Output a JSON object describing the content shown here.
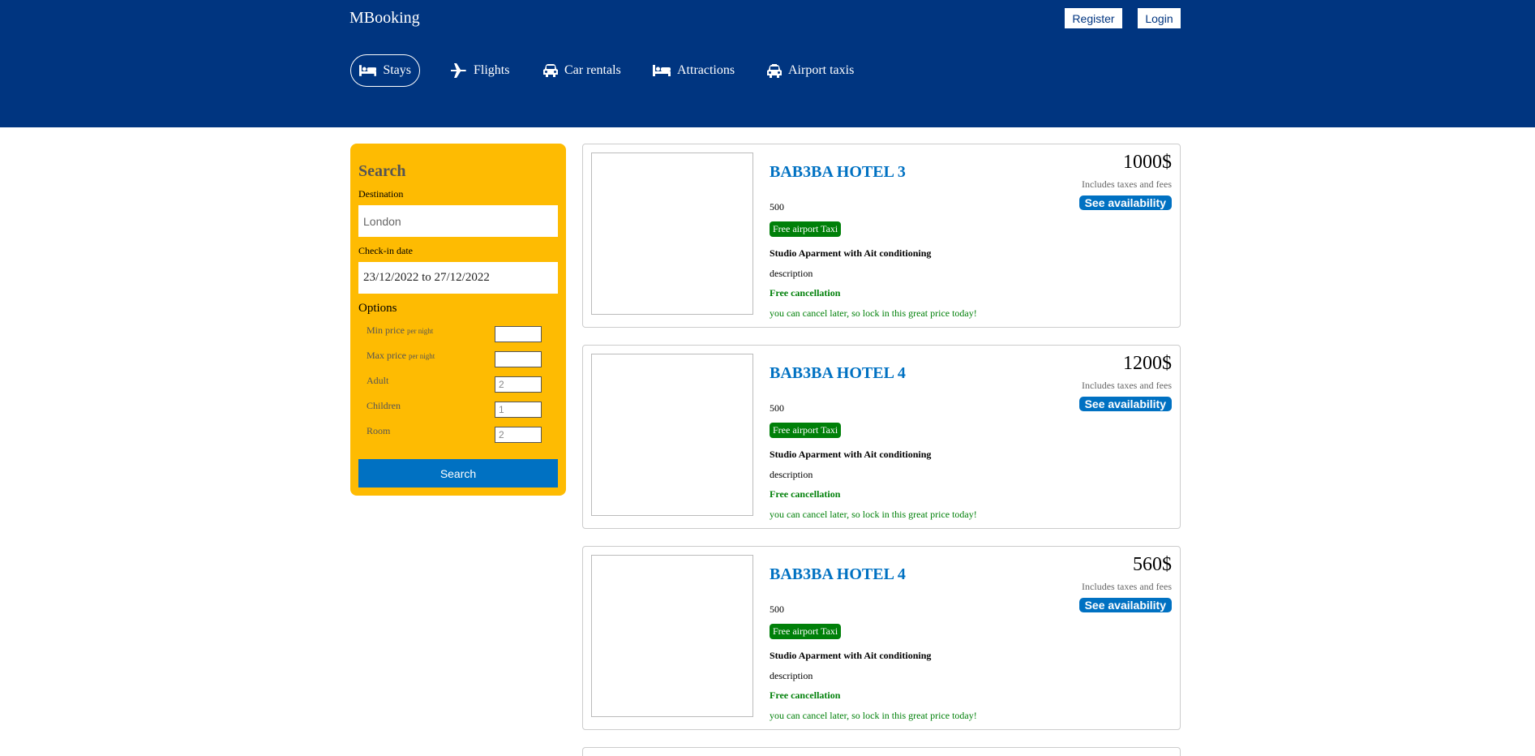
{
  "header": {
    "logo": "MBooking",
    "register_label": "Register",
    "login_label": "Login",
    "nav": [
      {
        "label": "Stays",
        "icon": "bed-icon",
        "active": true
      },
      {
        "label": "Flights",
        "icon": "plane-icon"
      },
      {
        "label": "Car rentals",
        "icon": "car-icon"
      },
      {
        "label": "Attractions",
        "icon": "bed-icon"
      },
      {
        "label": "Airport taxis",
        "icon": "taxi-icon"
      }
    ]
  },
  "search": {
    "title": "Search",
    "destination_label": "Destination",
    "destination_value": "London",
    "checkin_label": "Check-in date",
    "date_range": "23/12/2022 to 27/12/2022",
    "options_title": "Options",
    "options": [
      {
        "label": "Min price",
        "suffix": "per night",
        "value": ""
      },
      {
        "label": "Max price",
        "suffix": "per night",
        "value": ""
      },
      {
        "label": "Adult",
        "suffix": "",
        "value": "2"
      },
      {
        "label": "Children",
        "suffix": "",
        "value": "1"
      },
      {
        "label": "Room",
        "suffix": "",
        "value": "2"
      }
    ],
    "button_label": "Search"
  },
  "results": [
    {
      "title": "BAB3BA HOTEL 3",
      "distance": "500",
      "taxi": "Free airport Taxi",
      "subtitle": "Studio Aparment with Ait conditioning",
      "description": "description",
      "cancel": "Free cancellation",
      "cancel_sub": "you can cancel later, so lock in this great price today!",
      "price": "1000$",
      "tax_note": "Includes taxes and fees",
      "availability_label": "See availability"
    },
    {
      "title": "BAB3BA HOTEL 4",
      "distance": "500",
      "taxi": "Free airport Taxi",
      "subtitle": "Studio Aparment with Ait conditioning",
      "description": "description",
      "cancel": "Free cancellation",
      "cancel_sub": "you can cancel later, so lock in this great price today!",
      "price": "1200$",
      "tax_note": "Includes taxes and fees",
      "availability_label": "See availability"
    },
    {
      "title": "BAB3BA HOTEL 4",
      "distance": "500",
      "taxi": "Free airport Taxi",
      "subtitle": "Studio Aparment with Ait conditioning",
      "description": "description",
      "cancel": "Free cancellation",
      "cancel_sub": "you can cancel later, so lock in this great price today!",
      "price": "560$",
      "tax_note": "Includes taxes and fees",
      "availability_label": "See availability"
    }
  ],
  "colors": {
    "header": "#003580",
    "sidebar": "#febb02",
    "accent": "#0071c2",
    "green": "#008009"
  }
}
